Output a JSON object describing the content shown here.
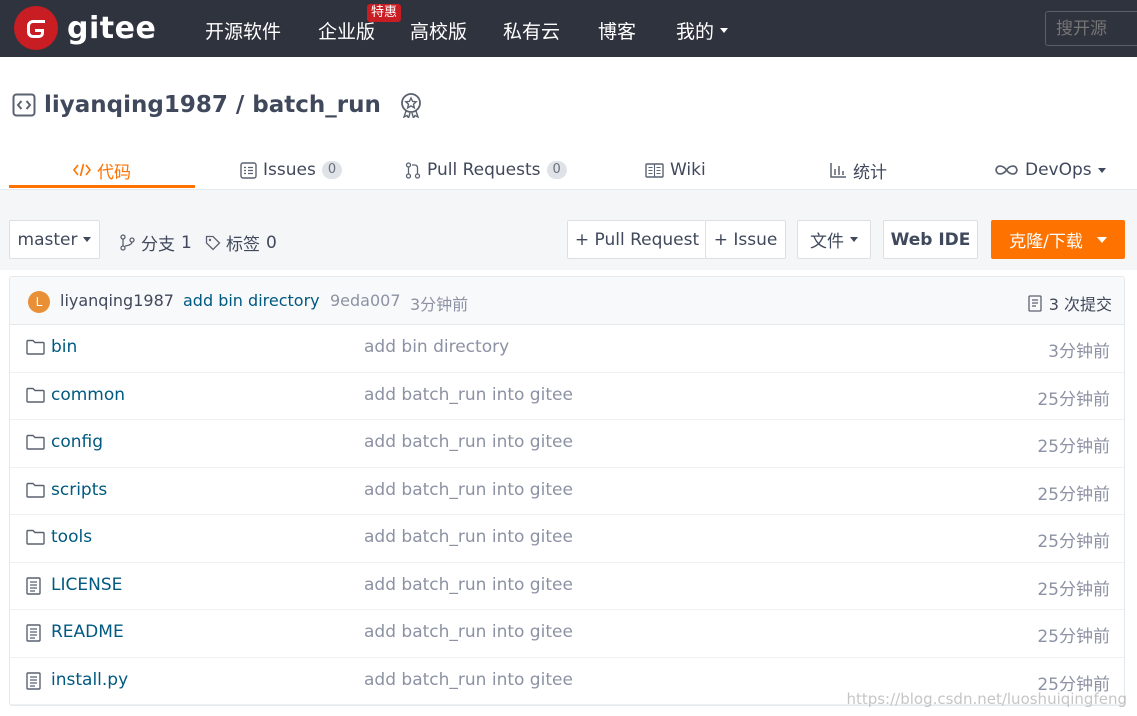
{
  "nav": {
    "logo_text": "gitee",
    "items": [
      "开源软件",
      "企业版",
      "高校版",
      "私有云",
      "博客",
      "我的"
    ],
    "hot_badge": "特惠",
    "search_placeholder": "搜开源"
  },
  "repo": {
    "owner": "liyanqing1987",
    "separator": "/",
    "name": "batch_run"
  },
  "tabs": [
    {
      "label": "代码"
    },
    {
      "label": "Issues",
      "count": "0"
    },
    {
      "label": "Pull Requests",
      "count": "0"
    },
    {
      "label": "Wiki"
    },
    {
      "label": "统计"
    },
    {
      "label": "DevOps"
    }
  ],
  "toolbar": {
    "branch": "master",
    "branches_label": "分支",
    "branches_count": "1",
    "tags_label": "标签",
    "tags_count": "0",
    "pull_request_label": "+ Pull Request",
    "issue_label": "+ Issue",
    "file_label": "文件",
    "webide_label": "Web IDE",
    "clone_label": "克隆/下载"
  },
  "latest_commit": {
    "avatar_letter": "L",
    "author": "liyanqing1987",
    "message": "add bin directory",
    "hash": "9eda007",
    "time": "3分钟前",
    "commit_count_text": "3 次提交"
  },
  "files": [
    {
      "type": "folder",
      "name": "bin",
      "message": "add bin directory",
      "time": "3分钟前"
    },
    {
      "type": "folder",
      "name": "common",
      "message": "add batch_run into gitee",
      "time": "25分钟前"
    },
    {
      "type": "folder",
      "name": "config",
      "message": "add batch_run into gitee",
      "time": "25分钟前"
    },
    {
      "type": "folder",
      "name": "scripts",
      "message": "add batch_run into gitee",
      "time": "25分钟前"
    },
    {
      "type": "folder",
      "name": "tools",
      "message": "add batch_run into gitee",
      "time": "25分钟前"
    },
    {
      "type": "file",
      "name": "LICENSE",
      "message": "add batch_run into gitee",
      "time": "25分钟前"
    },
    {
      "type": "file",
      "name": "README",
      "message": "add batch_run into gitee",
      "time": "25分钟前"
    },
    {
      "type": "file",
      "name": "install.py",
      "message": "add batch_run into gitee",
      "time": "25分钟前"
    }
  ],
  "watermark": "https://blog.csdn.net/luoshuiqingfeng",
  "colors": {
    "accent": "#fe7300",
    "nav_bg": "#2f333d",
    "brand_red": "#c71d23",
    "link": "#005980"
  }
}
